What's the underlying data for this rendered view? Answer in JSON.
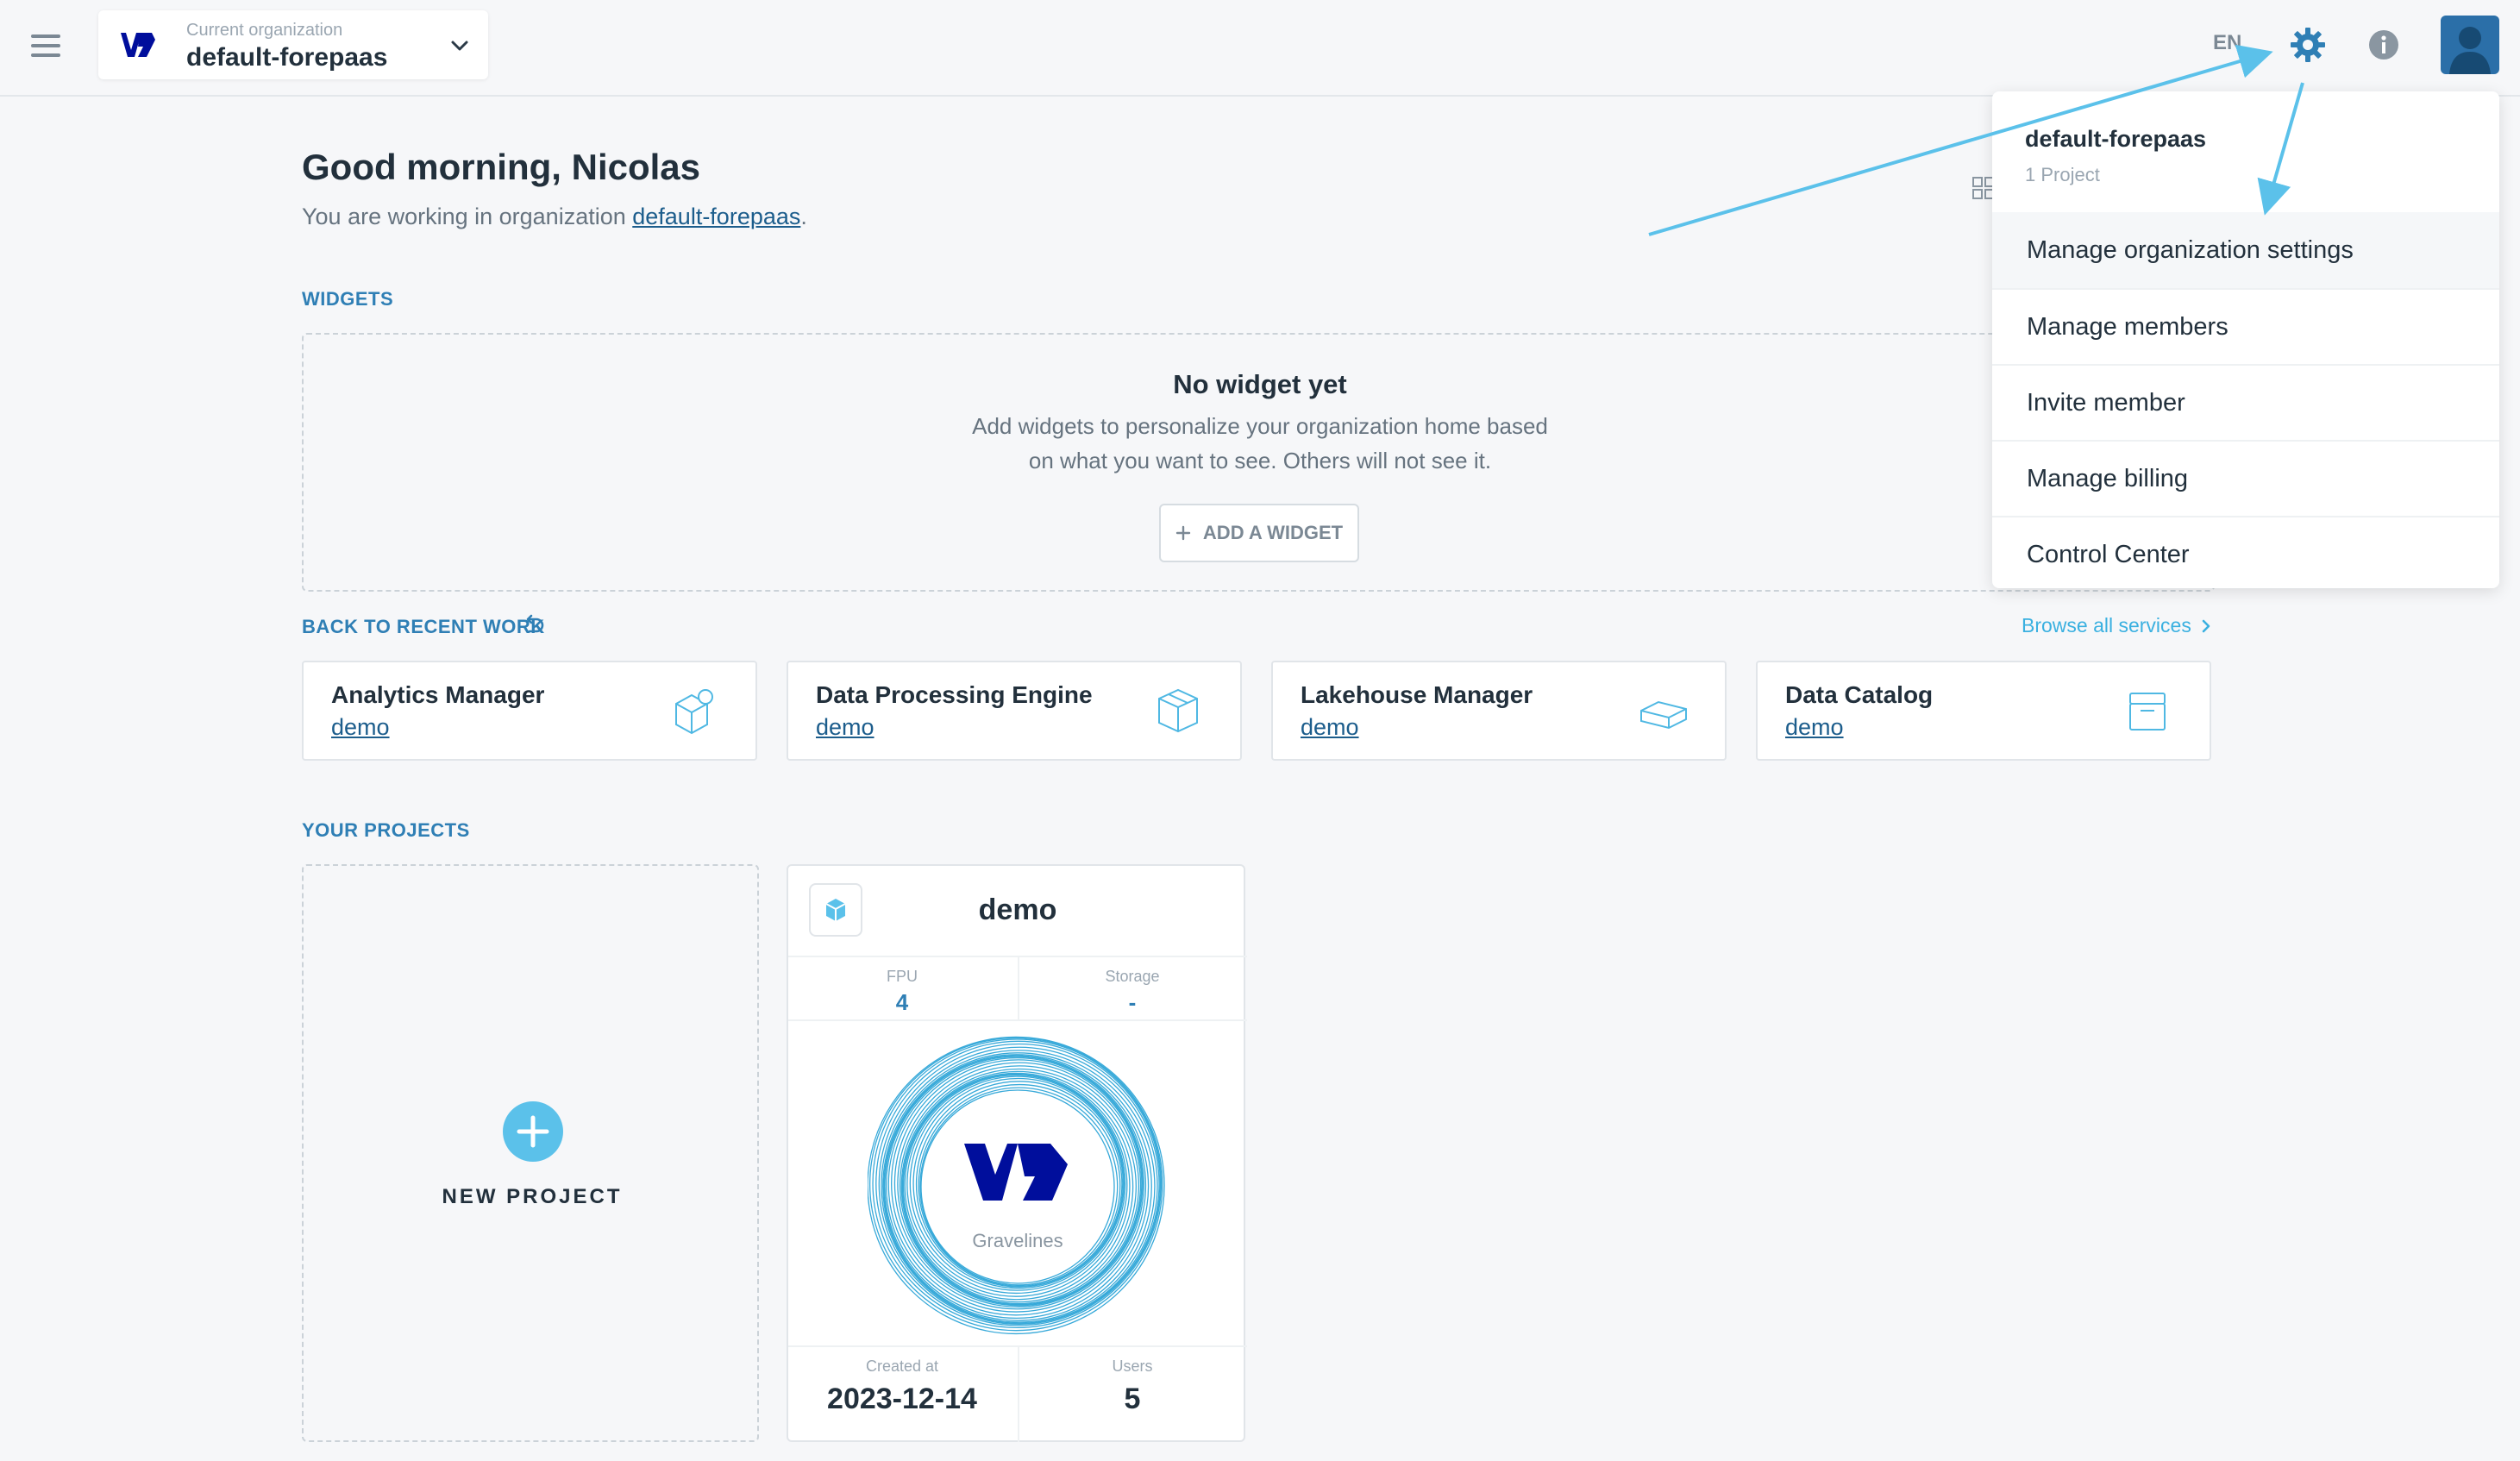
{
  "topbar": {
    "org_caption": "Current organization",
    "org_name": "default-forepaas",
    "language": "EN",
    "icons": [
      "menu-icon",
      "ovh-logo",
      "chevron-down-icon",
      "gear-icon",
      "info-icon",
      "user-avatar"
    ]
  },
  "greeting": {
    "title": "Good morning, Nicolas",
    "working_prefix": "You are working in organization ",
    "working_org": "default-forepaas",
    "working_suffix": "."
  },
  "widgets": {
    "section_label": "WIDGETS",
    "empty_title": "No widget yet",
    "empty_desc_line1": "Add widgets to personalize your organization home based",
    "empty_desc_line2": "on what you want to see. Others will not see it.",
    "add_button": "ADD A WIDGET"
  },
  "recent": {
    "section_label": "BACK TO RECENT WORK",
    "browse_link": "Browse all services",
    "services": [
      {
        "title": "Analytics Manager",
        "project": "demo",
        "icon": "analytics-icon"
      },
      {
        "title": "Data Processing Engine",
        "project": "demo",
        "icon": "processing-icon"
      },
      {
        "title": "Lakehouse Manager",
        "project": "demo",
        "icon": "lakehouse-icon"
      },
      {
        "title": "Data Catalog",
        "project": "demo",
        "icon": "catalog-icon"
      }
    ]
  },
  "projects": {
    "section_label": "YOUR PROJECTS",
    "new_project": "NEW PROJECT",
    "card": {
      "name": "demo",
      "fpu_label": "FPU",
      "fpu_value": "4",
      "storage_label": "Storage",
      "storage_value": "-",
      "region": "Gravelines",
      "created_label": "Created at",
      "created_value": "2023-12-14",
      "users_label": "Users",
      "users_value": "5"
    }
  },
  "dropdown": {
    "org_name": "default-forepaas",
    "project_count": "1 Project",
    "items": [
      "Manage organization settings",
      "Manage members",
      "Invite member",
      "Manage billing",
      "Control Center"
    ]
  },
  "colors": {
    "accent": "#3ab0e0",
    "link": "#1c5d8c",
    "brand": "#000e9c",
    "section": "#2f7fb5"
  }
}
